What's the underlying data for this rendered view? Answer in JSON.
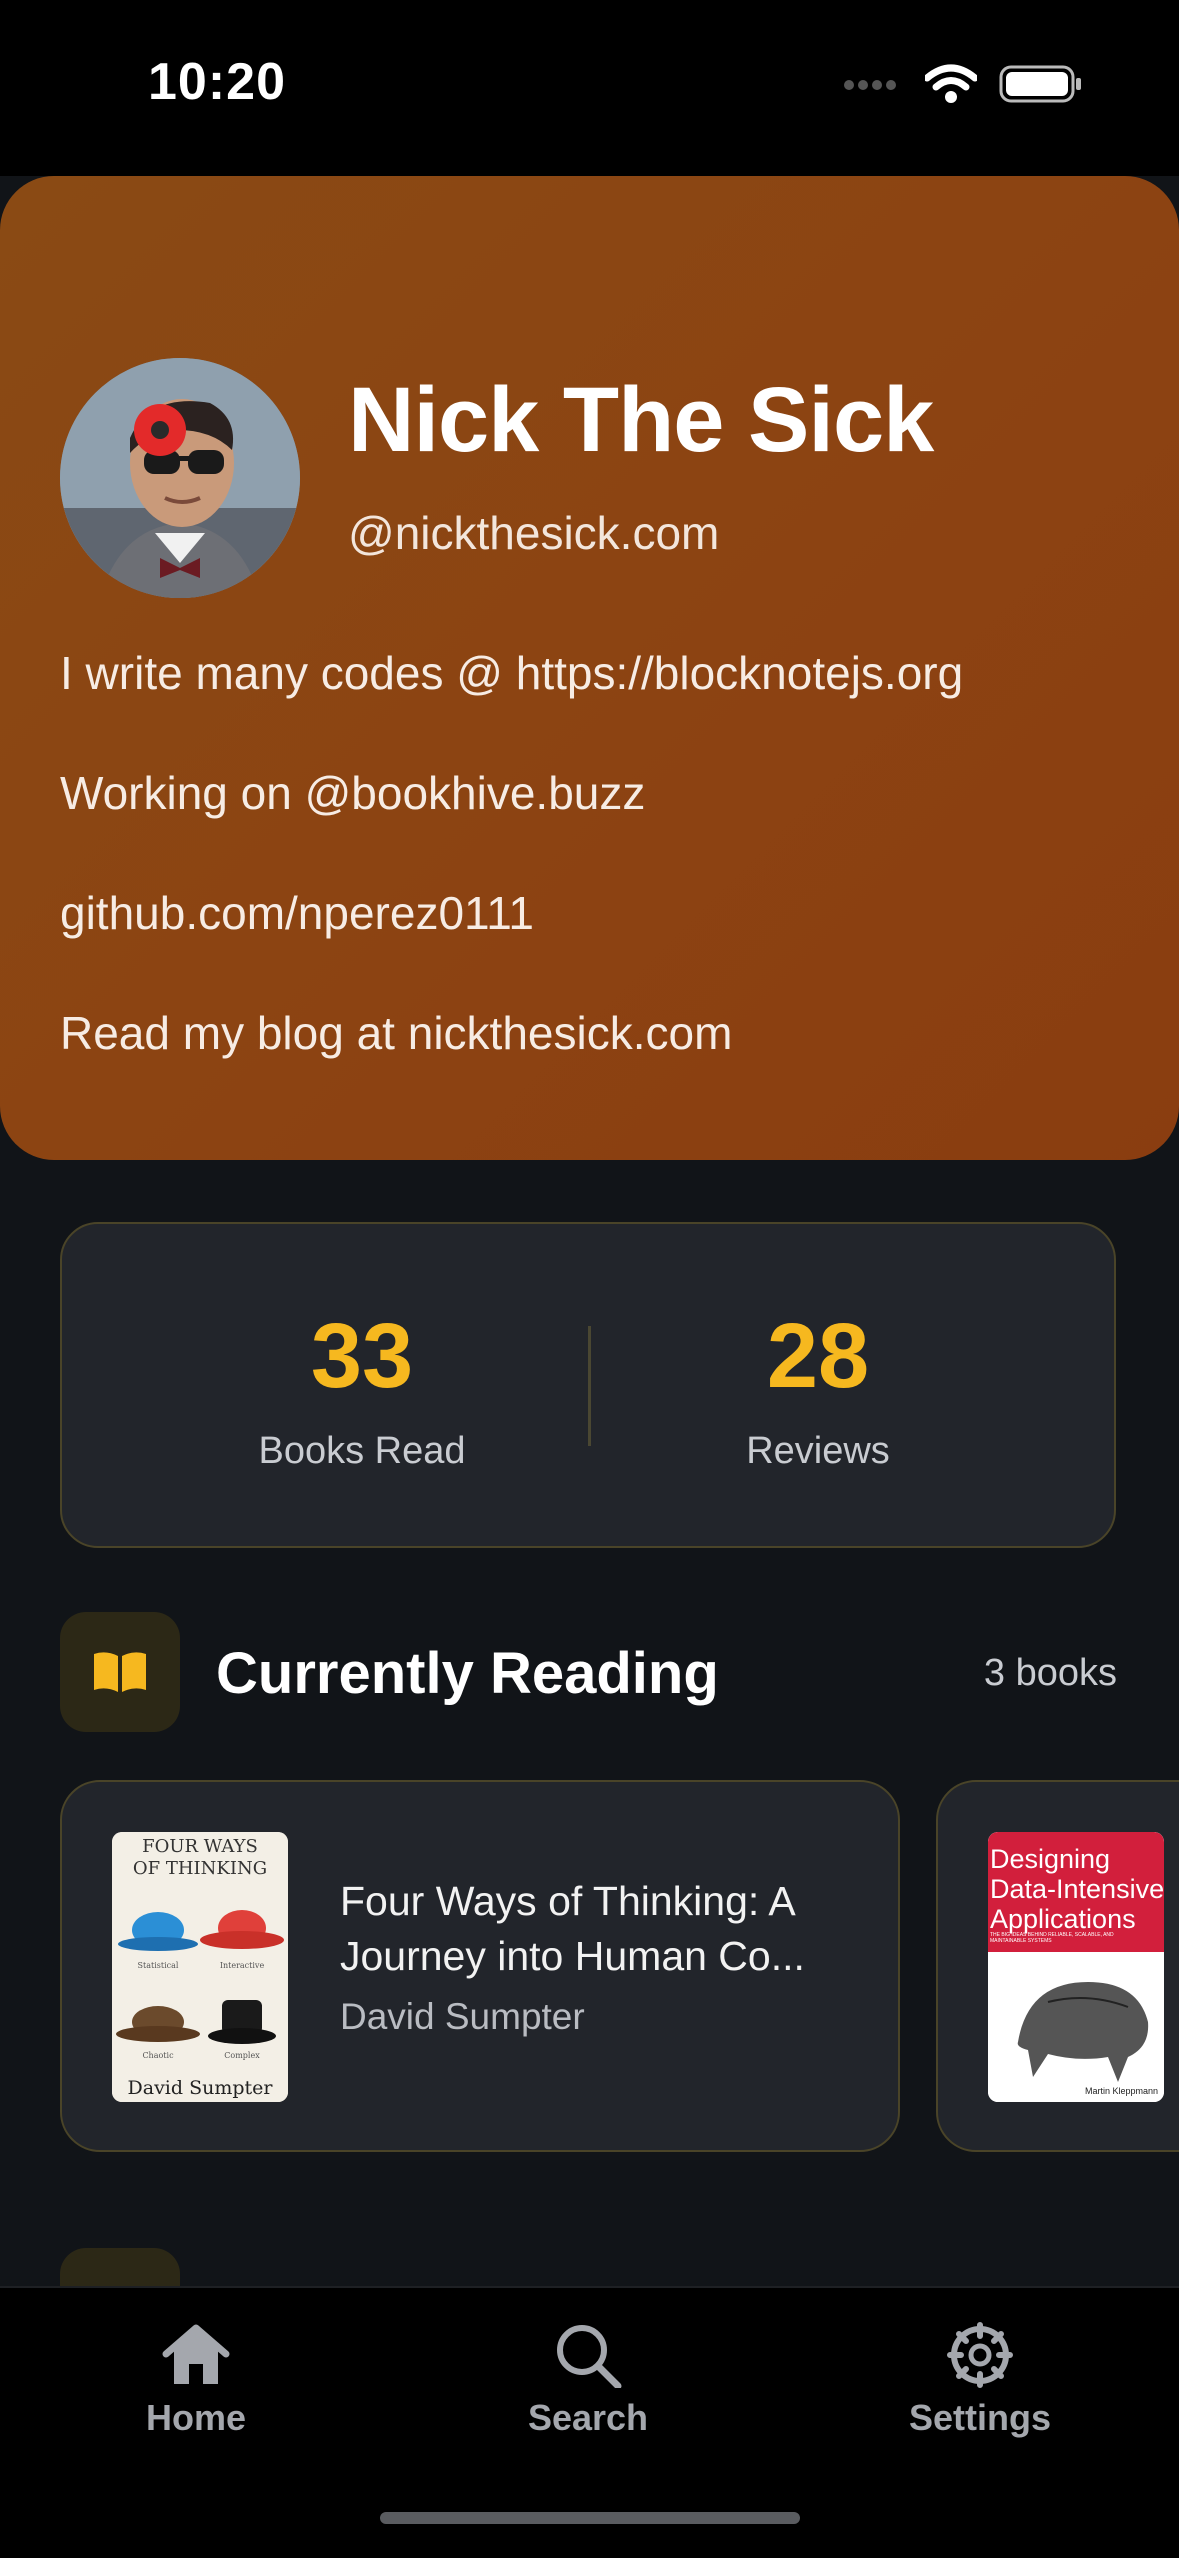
{
  "status_bar": {
    "time": "10:20"
  },
  "profile": {
    "name": "Nick The Sick",
    "handle": "@nickthesick.com",
    "bio_lines": [
      "I write many codes @ https://blocknotejs.org",
      "Working on @bookhive.buzz",
      "github.com/nperez0111",
      "Read my blog at nickthesick.com"
    ]
  },
  "stats": {
    "books_read_value": "33",
    "books_read_label": "Books Read",
    "reviews_value": "28",
    "reviews_label": "Reviews"
  },
  "currently_reading": {
    "title": "Currently Reading",
    "count": "3 books",
    "books": [
      {
        "title": "Four Ways of Thinking: A Journey into Human Co...",
        "author": "David Sumpter",
        "cover": {
          "title_line1": "FOUR WAYS",
          "title_line2": "OF THINKING",
          "labels": [
            "Statistical",
            "Interactive",
            "Chaotic",
            "Complex"
          ],
          "author": "David Sumpter"
        }
      },
      {
        "cover": {
          "title_line1": "Designing",
          "title_line2": "Data-Intensive",
          "title_line3": "Applications",
          "subtitle": "THE BIG IDEAS BEHIND RELIABLE, SCALABLE, AND MAINTAINABLE SYSTEMS",
          "author": "Martin Kleppmann"
        }
      }
    ]
  },
  "tab_bar": {
    "tabs": [
      {
        "label": "Home",
        "icon": "home-icon"
      },
      {
        "label": "Search",
        "icon": "search-icon"
      },
      {
        "label": "Settings",
        "icon": "gear-icon"
      }
    ]
  },
  "colors": {
    "accent": "#f6b81f",
    "hero_background": "#8c4312",
    "card_background": "#22252b",
    "page_background": "#111418"
  }
}
